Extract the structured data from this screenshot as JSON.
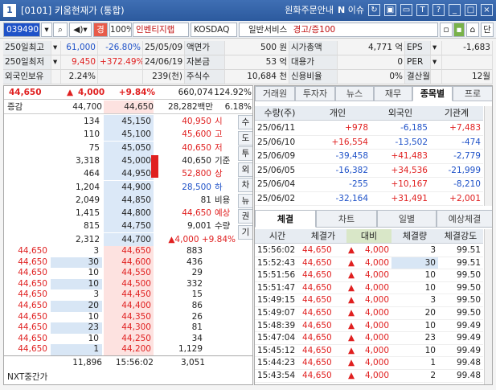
{
  "window": {
    "number": "1",
    "title": "[0101] 키움현재가 (통합)",
    "menu": "원화주문안내",
    "news": "이슈",
    "news_letter": "N"
  },
  "toolbar": {
    "code": "039490",
    "pct": "100%",
    "stock_name": "인벤티지랩",
    "market": "KOSDAQ",
    "sector": "일반서비스",
    "warning": "경고/증100",
    "btn_dan": "단"
  },
  "info": [
    [
      "250일최고",
      "▾",
      "61,000",
      "-26.80%",
      "25/05/09",
      "액면가",
      "500 원",
      "시가총액",
      "4,771 억",
      "EPS",
      "▾",
      "-1,683"
    ],
    [
      "250일최저",
      "▾",
      "9,450",
      "+372.49%",
      "24/06/19",
      "자본금",
      "53 억",
      "대용가",
      "0",
      "PER",
      "▾",
      ""
    ],
    [
      "외국인보유",
      "",
      "2.24%",
      "",
      "239(천)",
      "주식수",
      "10,684 천",
      "신용비율",
      "0%",
      "결산월",
      "",
      "12월"
    ]
  ],
  "price_bar": {
    "price": "44,650",
    "arrow": "▲",
    "change": "4,000",
    "rate": "+9.84%",
    "volume": "660,074",
    "vol_rate": "124.92%"
  },
  "order_header": {
    "label": "증감",
    "ask1": "44,700",
    "cur": "44,650",
    "amount": "28,282백만",
    "pct": "6.18%"
  },
  "asks": [
    {
      "qty": "134",
      "price": "45,150"
    },
    {
      "qty": "110",
      "price": "45,100"
    },
    {
      "qty": "75",
      "price": "45,050"
    },
    {
      "qty": "3,318",
      "price": "45,000"
    },
    {
      "qty": "464",
      "price": "44,950"
    },
    {
      "qty": "1,204",
      "price": "44,900"
    },
    {
      "qty": "2,049",
      "price": "44,850"
    },
    {
      "qty": "1,415",
      "price": "44,800"
    },
    {
      "qty": "815",
      "price": "44,750"
    },
    {
      "qty": "2,312",
      "price": "44,700"
    }
  ],
  "summary": [
    {
      "label": "시",
      "value": "40,950",
      "color": "red"
    },
    {
      "label": "고",
      "value": "45,600",
      "color": "red"
    },
    {
      "label": "저",
      "value": "40,650",
      "color": "red"
    },
    {
      "label": "기준",
      "value": "40,650",
      "color": "normal"
    },
    {
      "label": "상",
      "value": "52,800",
      "color": "red"
    },
    {
      "label": "하",
      "value": "28,500",
      "color": "blue"
    },
    {
      "label": "비용",
      "value": "81",
      "color": "normal"
    },
    {
      "label": "예상",
      "value": "44,650",
      "color": "red"
    },
    {
      "label": "수량",
      "value": "9,001",
      "color": "normal"
    },
    {
      "label": "",
      "value": "▲4,000 +9.84%",
      "color": "red"
    }
  ],
  "side_buttons": [
    "수",
    "도",
    "투",
    "외",
    "차",
    "뉴",
    "권",
    "기"
  ],
  "bids": [
    {
      "left": "44,650",
      "small": "3",
      "price": "44,650",
      "qty": "883"
    },
    {
      "left": "44,650",
      "small": "30",
      "price": "44,600",
      "qty": "436"
    },
    {
      "left": "44,650",
      "small": "10",
      "price": "44,550",
      "qty": "29"
    },
    {
      "left": "44,650",
      "small": "10",
      "price": "44,500",
      "qty": "332"
    },
    {
      "left": "44,650",
      "small": "3",
      "price": "44,450",
      "qty": "15"
    },
    {
      "left": "44,650",
      "small": "20",
      "price": "44,400",
      "qty": "86"
    },
    {
      "left": "44,650",
      "small": "10",
      "price": "44,350",
      "qty": "26"
    },
    {
      "left": "44,650",
      "small": "23",
      "price": "44,300",
      "qty": "81"
    },
    {
      "left": "44,650",
      "small": "10",
      "price": "44,250",
      "qty": "34"
    },
    {
      "left": "44,650",
      "small": "1",
      "price": "44,200",
      "qty": "1,129"
    }
  ],
  "left_footer": {
    "total_ask": "11,896",
    "time": "15:56:02",
    "total_bid": "3,051",
    "nxt": "NXT중간가"
  },
  "top_tabs": [
    "거래원",
    "투자자",
    "뉴스",
    "재무",
    "종목별",
    "프로"
  ],
  "investor": {
    "headers": [
      "수량(주)",
      "개인",
      "외국인",
      "기관계"
    ],
    "rows": [
      [
        "25/06/11",
        "+978",
        "-6,185",
        "+7,483"
      ],
      [
        "25/06/10",
        "+16,554",
        "-13,502",
        "-474"
      ],
      [
        "25/06/09",
        "-39,458",
        "+41,483",
        "-2,779"
      ],
      [
        "25/06/05",
        "-16,382",
        "+34,536",
        "-21,999"
      ],
      [
        "25/06/04",
        "-255",
        "+10,167",
        "-8,210"
      ],
      [
        "25/06/02",
        "-32,164",
        "+31,491",
        "+2,001"
      ]
    ]
  },
  "bottom_tabs": [
    "체결",
    "차트",
    "일별",
    "예상체결"
  ],
  "trades": {
    "headers": [
      "시간",
      "체결가",
      "대비",
      "체결량",
      "체결강도"
    ],
    "rows": [
      [
        "15:56:02",
        "44,650",
        "4,000",
        "3",
        "99.51"
      ],
      [
        "15:52:43",
        "44,650",
        "4,000",
        "30",
        "99.51"
      ],
      [
        "15:51:56",
        "44,650",
        "4,000",
        "10",
        "99.50"
      ],
      [
        "15:51:47",
        "44,650",
        "4,000",
        "10",
        "99.50"
      ],
      [
        "15:49:15",
        "44,650",
        "4,000",
        "3",
        "99.50"
      ],
      [
        "15:49:07",
        "44,650",
        "4,000",
        "20",
        "99.50"
      ],
      [
        "15:48:39",
        "44,650",
        "4,000",
        "10",
        "99.49"
      ],
      [
        "15:47:04",
        "44,650",
        "4,000",
        "23",
        "99.49"
      ],
      [
        "15:45:12",
        "44,650",
        "4,000",
        "10",
        "99.49"
      ],
      [
        "15:44:23",
        "44,650",
        "4,000",
        "1",
        "99.48"
      ],
      [
        "15:43:54",
        "44,650",
        "4,000",
        "2",
        "99.48"
      ]
    ]
  },
  "colors": {
    "title": "#2c5a9e",
    "ask_bg": "#dbe8f7",
    "bid_bg": "#fde2e0",
    "up": "#e02020",
    "down": "#1f52c8"
  }
}
